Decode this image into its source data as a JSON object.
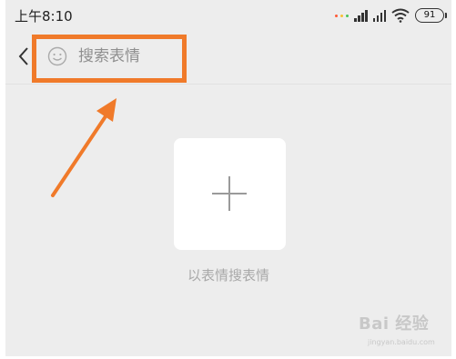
{
  "status_bar": {
    "time": "上午8:10",
    "battery": "91",
    "dot_colors": [
      "#ff5a36",
      "#f7c133",
      "#49c45a"
    ],
    "icons": [
      "colored-dots-icon",
      "signal-icon",
      "signal-icon",
      "wifi-icon",
      "battery-icon"
    ]
  },
  "search": {
    "back_icon": "chevron-left-icon",
    "emoji_icon": "smiley-face-icon",
    "placeholder": "搜索表情"
  },
  "content": {
    "add_icon": "plus-icon",
    "caption": "以表情搜表情"
  },
  "watermark": {
    "main": "Bai 经验",
    "sub": "jingyan.baidu.com"
  },
  "annotation": {
    "highlight_color": "#f07a2a",
    "arrow_color": "#f07a2a"
  }
}
